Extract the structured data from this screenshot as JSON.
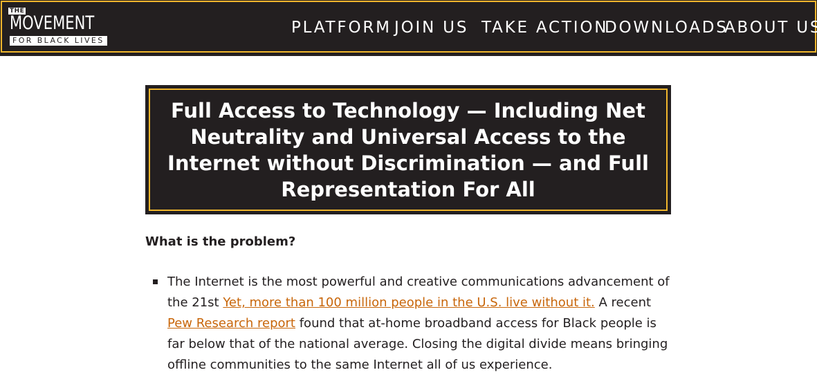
{
  "header": {
    "logo": {
      "the": "THE",
      "movement": "MOVEMENT",
      "for_black_lives": "FOR BLACK LIVES"
    },
    "nav": [
      {
        "label": "PLATFORM"
      },
      {
        "label": "JOIN US"
      },
      {
        "label": "TAKE ACTION"
      },
      {
        "label": "DOWNLOADS"
      },
      {
        "label": "ABOUT US"
      }
    ]
  },
  "main": {
    "title": "Full Access to Technology — Including Net Neutrality and Universal Access to the Internet without Discrimination — and Full Representation For All",
    "problem_heading": "What is the problem?",
    "bullets": [
      {
        "text_1": "The Internet is the most powerful and creative communications advancement of the 21st ",
        "link_1": "Yet, more than 100 million people in the U.S. live without it.",
        "text_2": " A recent ",
        "link_2": "Pew Research report",
        "text_3": " found that at-home broadband access for Black people is far below that of the national average. Closing the digital divide means bringing offline communities to the same Internet all of us experience."
      }
    ]
  },
  "colors": {
    "dark": "#231f20",
    "accent_gold": "#f0b62c",
    "link_orange": "#c8660a",
    "white": "#ffffff"
  }
}
